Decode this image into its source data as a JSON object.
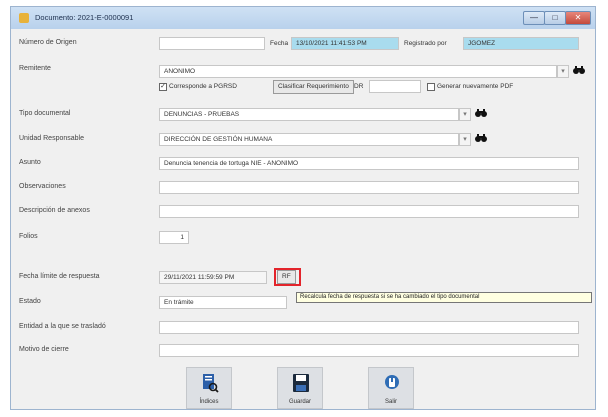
{
  "window": {
    "title": "Documento: 2021-E-0000091",
    "controls": {
      "minimize": "—",
      "maximize": "□",
      "close": "✕"
    }
  },
  "form": {
    "numero_origen_label": "Número de Origen",
    "numero_origen_value": "",
    "fecha_label": "Fecha",
    "fecha_value": "13/10/2021 11:41:53 PM",
    "registrado_por_label": "Registrado por",
    "registrado_por_value": "JGOMEZ",
    "remitente_label": "Remitente",
    "remitente_value": "ANONIMO",
    "corresponde_pgrsd_label": "Corresponde a PGRSD",
    "clasificar_button": "Clasificar Requerimiento",
    "dr_label": "DR",
    "generar_pdf_label": "Generar nuevamente PDF",
    "tipo_documental_label": "Tipo documental",
    "tipo_documental_value": "DENUNCIAS - PRUEBAS",
    "unidad_responsable_label": "Unidad Responsable",
    "unidad_responsable_value": "DIRECCIÓN DE GESTIÓN HUMANA",
    "asunto_label": "Asunto",
    "asunto_value": "Denuncia tenencia de tortuga NIE - ANONIMO",
    "observaciones_label": "Observaciones",
    "observaciones_value": "",
    "descripcion_anexos_label": "Descripción de anexos",
    "descripcion_anexos_value": "",
    "folios_label": "Folios",
    "folios_value": "1",
    "fecha_limite_label": "Fecha límite de respuesta",
    "fecha_limite_value": "29/11/2021 11:59:59 PM",
    "rf_button": "RF",
    "estado_label": "Estado",
    "estado_value": "En trámite",
    "entidad_label": "Entidad a la que se trasladó",
    "entidad_value": "",
    "motivo_label": "Motivo de cierre",
    "motivo_value": "",
    "tooltip": "Recalcula fecha de respuesta si se ha cambiado el tipo documental"
  },
  "icons": {
    "search": "search-binoculars-icon",
    "dropdown": "chevron-down-icon"
  },
  "bottom_buttons": {
    "indices": "Índices",
    "guardar": "Guardar",
    "salir": "Salir"
  },
  "colors": {
    "highlight": "#e3242b",
    "fecha_field": "#a9dcee",
    "tooltip_bg": "#ffffe1"
  }
}
